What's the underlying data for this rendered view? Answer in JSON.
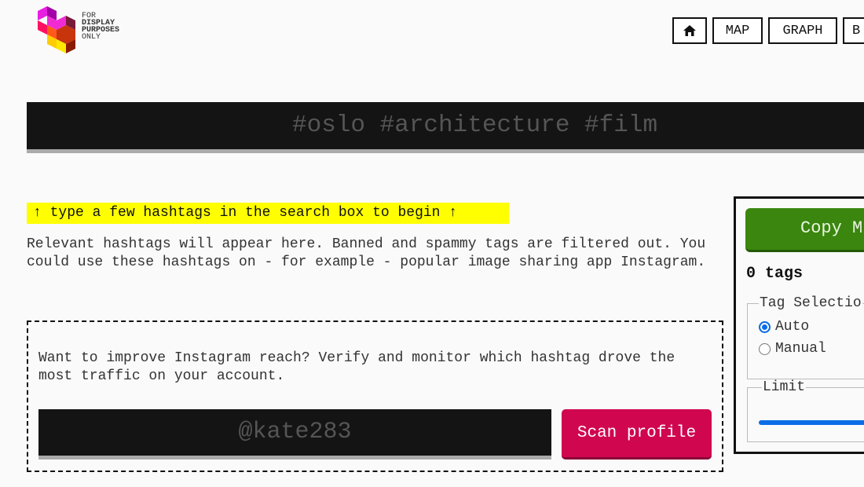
{
  "logo": {
    "line1": "FOR",
    "line2": "DISPLAY",
    "line3": "PURPOSES",
    "line4": "ONLY"
  },
  "nav": {
    "home_icon": "home-icon",
    "home_glyph": "⌂",
    "map": "MAP",
    "graph": "GRAPH",
    "more": "B"
  },
  "search": {
    "placeholder": "#oslo #architecture #film"
  },
  "hint": "↑ type a few hashtags in the search box to begin ↑",
  "description": "Relevant hashtags will appear here. Banned and spammy tags are filtered out. You could use these hashtags on - for example - popular image sharing app Instagram.",
  "scan": {
    "text": "Want to improve Instagram reach? Verify and monitor which hashtag drove the most traffic on your account.",
    "placeholder": "@kate283",
    "button": "Scan profile"
  },
  "panel": {
    "copy_button": "Copy M",
    "tag_count": "0 tags",
    "tag_selection": {
      "legend": "Tag Selectio",
      "options": [
        "Auto",
        "Manual"
      ],
      "selected": "Auto"
    },
    "limit": {
      "legend": "Limit",
      "value_fraction": 0.95
    },
    "colors": {
      "copy": "#3a860e",
      "scan": "#d0064f",
      "hint": "#ffff00",
      "accent": "#0b6ce8"
    }
  }
}
